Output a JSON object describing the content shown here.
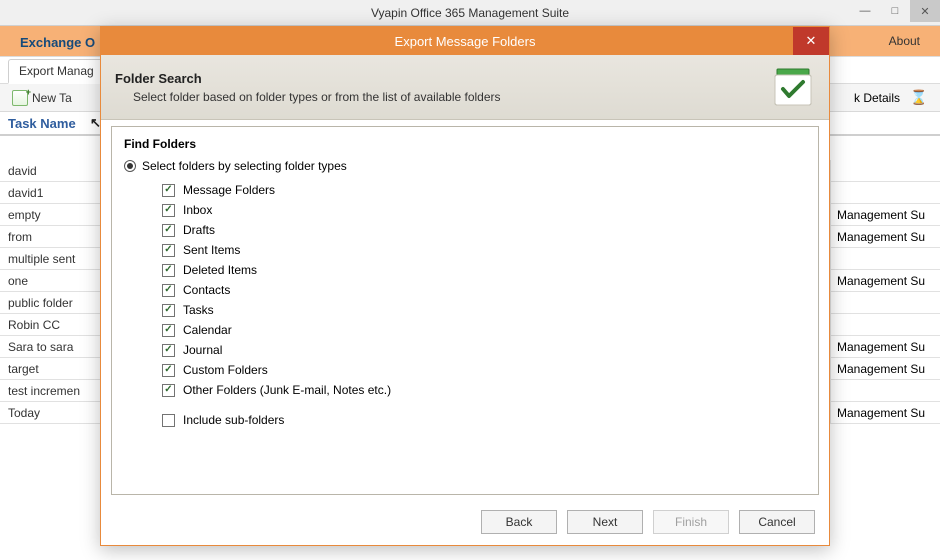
{
  "app": {
    "title": "Vyapin Office 365 Management Suite"
  },
  "ribbon": {
    "left_tab": "Exchange O",
    "right_tab": "About",
    "sub_tab": "Export Manag"
  },
  "toolbar": {
    "new_task": "New Ta",
    "right_label": "k Details"
  },
  "tasklist_header": "Task Name",
  "tasks": [
    {
      "name": "david",
      "prod": ""
    },
    {
      "name": "david1",
      "prod": ""
    },
    {
      "name": "empty",
      "prod": "Management Su"
    },
    {
      "name": "from",
      "prod": "Management Su"
    },
    {
      "name": "multiple sent",
      "prod": ""
    },
    {
      "name": "one",
      "prod": "Management Su"
    },
    {
      "name": "public folder",
      "prod": ""
    },
    {
      "name": "Robin CC",
      "prod": ""
    },
    {
      "name": "Sara to sara",
      "prod": "Management Su"
    },
    {
      "name": "target",
      "prod": "Management Su"
    },
    {
      "name": "test incremen",
      "prod": ""
    },
    {
      "name": "Today",
      "prod": "Management Su"
    }
  ],
  "dialog": {
    "title": "Export Message Folders",
    "header_title": "Folder Search",
    "header_desc": "Select folder based on folder types or from the list of available folders",
    "find_title": "Find Folders",
    "radio_label": "Select folders by selecting folder types",
    "checks": [
      {
        "label": "Message Folders",
        "checked": true
      },
      {
        "label": "Inbox",
        "checked": true
      },
      {
        "label": "Drafts",
        "checked": true
      },
      {
        "label": "Sent Items",
        "checked": true
      },
      {
        "label": "Deleted Items",
        "checked": true
      },
      {
        "label": "Contacts",
        "checked": true
      },
      {
        "label": "Tasks",
        "checked": true
      },
      {
        "label": "Calendar",
        "checked": true
      },
      {
        "label": "Journal",
        "checked": true
      },
      {
        "label": "Custom Folders",
        "checked": true
      },
      {
        "label": "Other Folders (Junk E-mail, Notes etc.)",
        "checked": true
      }
    ],
    "include_sub": "Include sub-folders",
    "buttons": {
      "back": "Back",
      "next": "Next",
      "finish": "Finish",
      "cancel": "Cancel"
    }
  }
}
